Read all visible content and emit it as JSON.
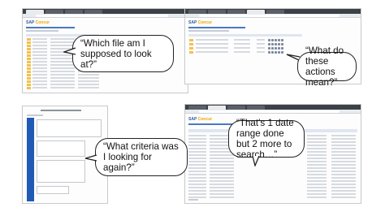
{
  "panels": {
    "p1": {
      "app_logo": {
        "brand": "SAP",
        "product": "Concur"
      },
      "quote": "“Which file am I supposed to look at?”"
    },
    "p2": {
      "app_logo": {
        "brand": "SAP",
        "product": "Concur"
      },
      "quote": "“What do these actions mean?”"
    },
    "p3": {
      "quote": "“What criteria was I looking for again?”"
    },
    "p4": {
      "app_logo": {
        "brand": "SAP",
        "product": "Concur"
      },
      "quote": "“That’s 1 date range done but 2 more to search…”"
    }
  },
  "colors": {
    "sap_blue": "#2a5ea7",
    "concur_orange": "#f0a500",
    "folder_yellow": "#f2c14e",
    "form_blue": "#1f5bb5"
  }
}
